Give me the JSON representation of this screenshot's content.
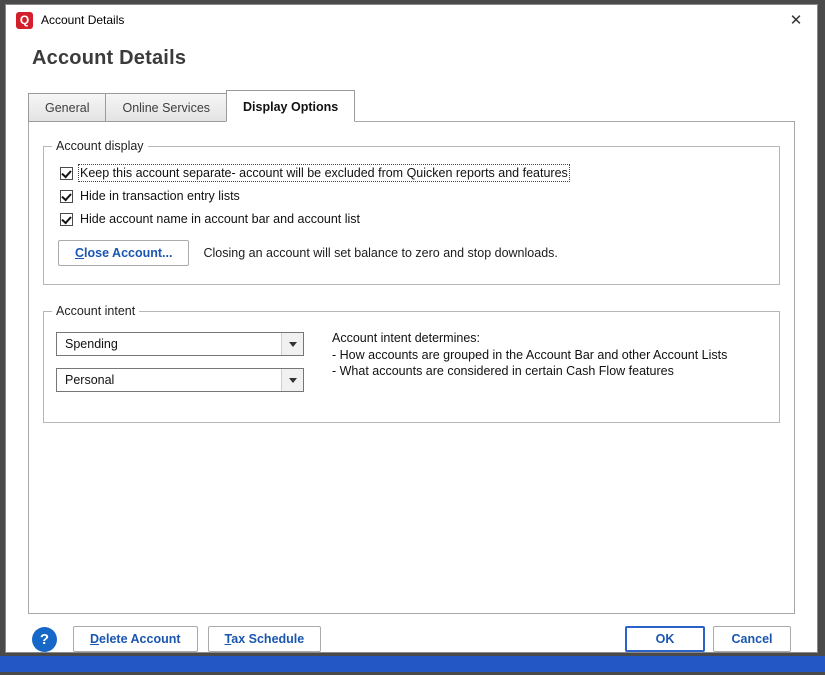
{
  "window": {
    "title": "Account Details",
    "logo_glyph": "Q",
    "close_glyph": "✕"
  },
  "header": {
    "title": "Account Details"
  },
  "tabs": [
    {
      "label": "General",
      "active": false
    },
    {
      "label": "Online Services",
      "active": false
    },
    {
      "label": "Display Options",
      "active": true
    }
  ],
  "account_display": {
    "legend": "Account display",
    "checkboxes": [
      {
        "label": "Keep this account separate- account will be excluded from Quicken reports and features",
        "checked": true
      },
      {
        "label": "Hide in transaction entry lists",
        "checked": true
      },
      {
        "label": "Hide account name in account bar and account list",
        "checked": true
      }
    ],
    "close_account_button": {
      "mnemonic": "C",
      "rest": "lose Account..."
    },
    "close_account_note": "Closing an account will set balance to zero and stop downloads."
  },
  "account_intent": {
    "legend": "Account intent",
    "dropdowns": [
      {
        "value": "Spending"
      },
      {
        "value": "Personal"
      }
    ],
    "description_lines": [
      "Account intent determines:",
      "- How accounts are grouped in the Account Bar and other Account Lists",
      "- What accounts are considered in certain Cash Flow features"
    ]
  },
  "footer": {
    "help_glyph": "?",
    "delete_account": {
      "mnemonic": "D",
      "rest": "elete Account"
    },
    "tax_schedule": {
      "mnemonic": "T",
      "rest": "ax Schedule"
    },
    "ok_label": "OK",
    "cancel_label": "Cancel"
  }
}
